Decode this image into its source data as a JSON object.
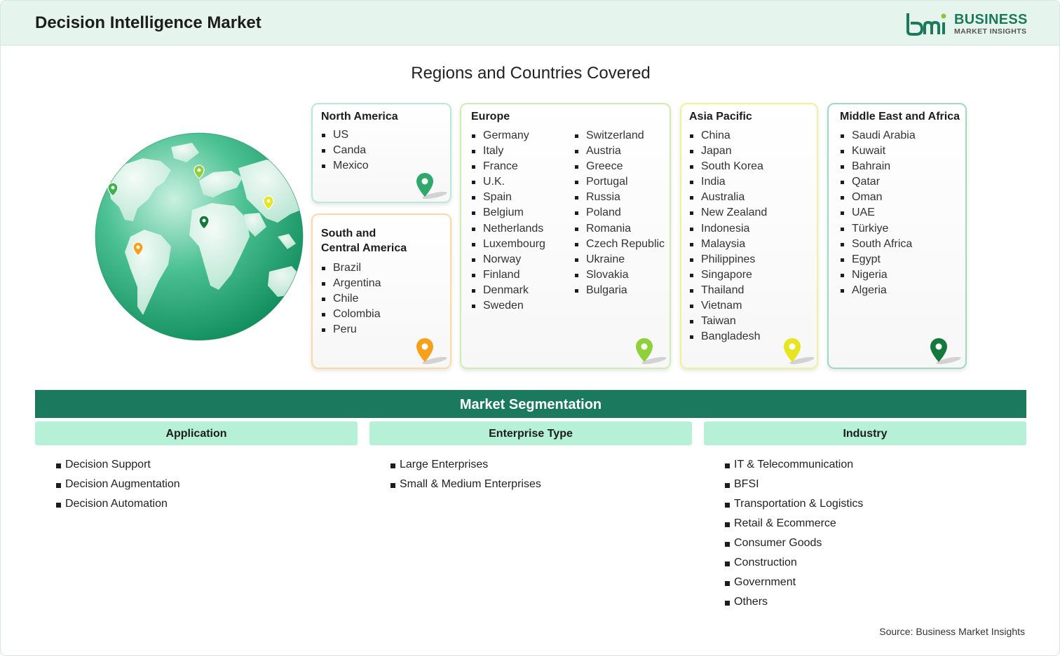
{
  "header": {
    "title": "Decision Intelligence Market",
    "logo_top": "BUSINESS",
    "logo_bottom": "MARKET INSIGHTS"
  },
  "regions": {
    "title": "Regions and Countries Covered",
    "north_america": {
      "title": "North America",
      "countries": [
        "US",
        "Canda",
        "Mexico"
      ],
      "pin_color": "#2ea86b"
    },
    "south_america": {
      "title_line1": "South and",
      "title_line2": "Central America",
      "countries": [
        "Brazil",
        "Argentina",
        "Chile",
        "Colombia",
        "Peru"
      ],
      "pin_color": "#f5a11c"
    },
    "europe": {
      "title": "Europe",
      "countries_col1": [
        "Germany",
        "Italy",
        "France",
        "U.K.",
        "Spain",
        "Belgium",
        "Netherlands",
        "Luxembourg",
        "Norway",
        "Finland",
        "Denmark",
        "Sweden"
      ],
      "countries_col2": [
        "Switzerland",
        "Austria",
        "Greece",
        "Portugal",
        "Russia",
        "Poland",
        "Romania",
        "Czech Republic",
        "Ukraine",
        "Slovakia",
        "Bulgaria"
      ],
      "pin_color": "#8ed13a"
    },
    "asia_pacific": {
      "title": "Asia Pacific",
      "countries": [
        "China",
        "Japan",
        "South Korea",
        "India",
        "Australia",
        "New Zealand",
        "Indonesia",
        "Malaysia",
        "Philippines",
        "Singapore",
        "Thailand",
        "Vietnam",
        "Taiwan",
        "Bangladesh"
      ],
      "pin_color": "#e6e51f"
    },
    "mea": {
      "title": "Middle East and Africa",
      "countries": [
        "Saudi Arabia",
        "Kuwait",
        "Bahrain",
        "Qatar",
        "Oman",
        "UAE",
        "Türkiye",
        "South Africa",
        "Egypt",
        "Nigeria",
        "Algeria"
      ],
      "pin_color": "#147a3c"
    }
  },
  "segmentation": {
    "title": "Market Segmentation",
    "application": {
      "title": "Application",
      "items": [
        "Decision Support",
        "Decision Augmentation",
        "Decision Automation"
      ]
    },
    "enterprise_type": {
      "title": "Enterprise Type",
      "items": [
        "Large Enterprises",
        "Small & Medium Enterprises"
      ]
    },
    "industry": {
      "title": "Industry",
      "items": [
        "IT & Telecommunication",
        "BFSI",
        "Transportation & Logistics",
        "Retail & Ecommerce",
        "Consumer Goods",
        "Construction",
        "Government",
        "Others"
      ]
    }
  },
  "source": "Source: Business Market Insights",
  "colors": {
    "brand_green": "#1b7a5d",
    "header_bg": "#e6f4ee",
    "segment_header_bg": "#b5f0d7"
  }
}
